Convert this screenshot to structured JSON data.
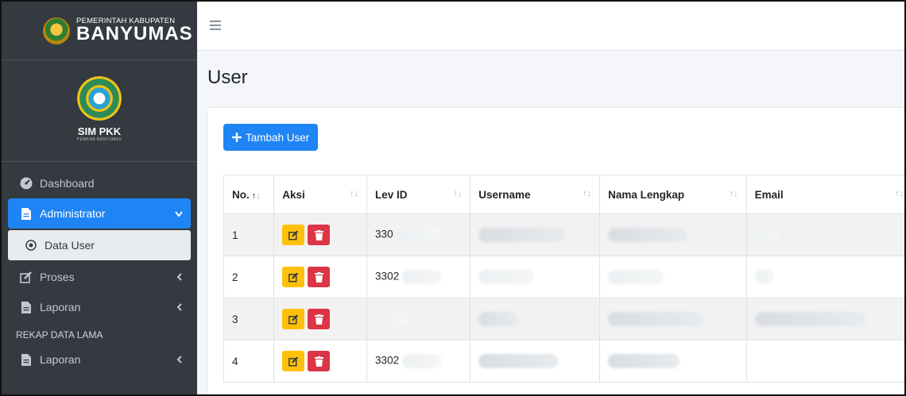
{
  "brand": {
    "top": "PEMERINTAH KABUPATEN",
    "main": "BANYUMAS"
  },
  "panel": {
    "title": "SIM PKK",
    "subtitle": "PEMKAB BANYUMAS"
  },
  "sidebar": {
    "items": [
      {
        "label": "Dashboard",
        "icon": "dashboard-icon"
      },
      {
        "label": "Administrator",
        "icon": "file-icon",
        "active": true
      },
      {
        "label": "Data User",
        "icon": "circle-dot-icon"
      },
      {
        "label": "Proses",
        "icon": "edit-icon"
      },
      {
        "label": "Laporan",
        "icon": "file-icon"
      },
      {
        "label": "REKAP DATA LAMA"
      },
      {
        "label": "Laporan",
        "icon": "file-icon"
      }
    ]
  },
  "page": {
    "title": "User",
    "add_button": "Tambah User"
  },
  "table": {
    "headers": [
      "No.",
      "Aksi",
      "Lev ID",
      "Username",
      "Nama Lengkap",
      "Email"
    ],
    "rows": [
      {
        "no": "1",
        "lev_id": "330"
      },
      {
        "no": "2",
        "lev_id": "3302"
      },
      {
        "no": "3",
        "lev_id": ""
      },
      {
        "no": "4",
        "lev_id": "3302"
      }
    ]
  },
  "colors": {
    "sidebar_bg": "#343a40",
    "accent": "#1f84f4",
    "edit": "#ffc107",
    "delete": "#dc3545"
  }
}
